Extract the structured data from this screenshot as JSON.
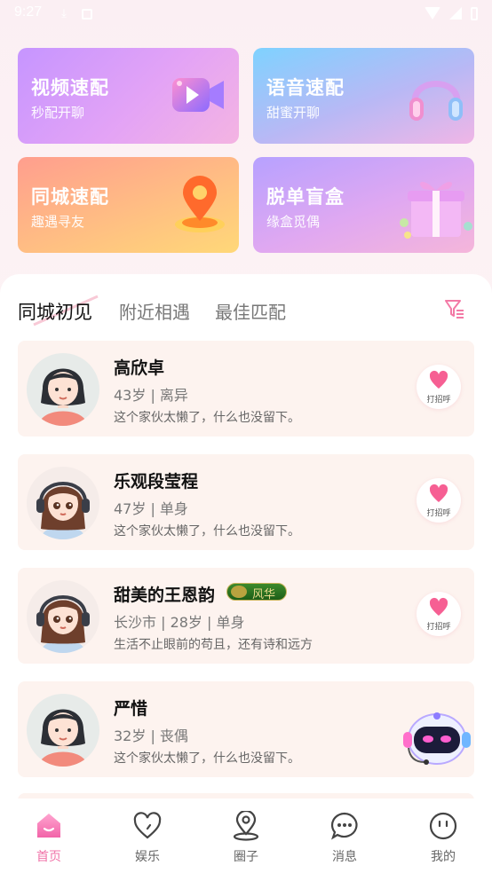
{
  "status_bar": {
    "time": "9:27"
  },
  "feature_cards": [
    {
      "title": "视频速配",
      "subtitle": "秒配开聊",
      "icon": "video-camera-icon"
    },
    {
      "title": "语音速配",
      "subtitle": "甜蜜开聊",
      "icon": "headphones-icon"
    },
    {
      "title": "同城速配",
      "subtitle": "趣遇寻友",
      "icon": "location-pin-icon"
    },
    {
      "title": "脱单盲盒",
      "subtitle": "缘盒觅偶",
      "icon": "gift-box-icon"
    }
  ],
  "tabs": [
    {
      "label": "同城初见",
      "active": true
    },
    {
      "label": "附近相遇",
      "active": false
    },
    {
      "label": "最佳匹配",
      "active": false
    }
  ],
  "users": [
    {
      "name": "高欣卓",
      "info": "43岁 | 离异",
      "bio": "这个家伙太懒了，什么也没留下。",
      "avatar": "female-default-avatar"
    },
    {
      "name": "乐观段莹程",
      "info": "47岁 | 单身",
      "bio": "这个家伙太懒了，什么也没留下。",
      "avatar": "girl-headphones-avatar"
    },
    {
      "name": "甜美的王恩韵",
      "info": "长沙市 | 28岁 | 单身",
      "bio": "生活不止眼前的苟且，还有诗和远方",
      "avatar": "girl-headphones-avatar",
      "badge": "风华"
    },
    {
      "name": "严惜",
      "info": "32岁 | 丧偶",
      "bio": "这个家伙太懒了，什么也没留下。",
      "avatar": "female-default-avatar"
    }
  ],
  "greet_label": "打招呼",
  "bottom_nav": [
    {
      "label": "首页",
      "icon": "home-icon",
      "active": true
    },
    {
      "label": "娱乐",
      "icon": "heart-icon",
      "active": false
    },
    {
      "label": "圈子",
      "icon": "location-icon",
      "active": false
    },
    {
      "label": "消息",
      "icon": "chat-bubble-icon",
      "active": false
    },
    {
      "label": "我的",
      "icon": "smiley-face-icon",
      "active": false
    }
  ],
  "colors": {
    "accent": "#f073a8",
    "card_bg": "#fdf3ef",
    "badge_green": "#2e7a22"
  }
}
